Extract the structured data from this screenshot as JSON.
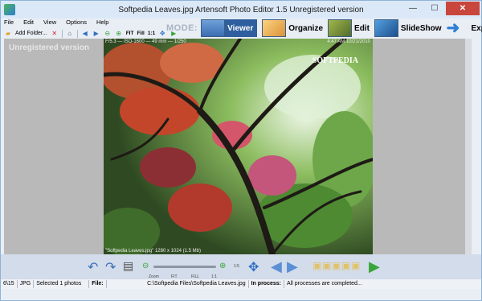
{
  "window": {
    "title": "Softpedia Leaves.jpg        Artensoft Photo Editor 1.5  Unregistered version",
    "min_symbol": "—",
    "max_symbol": "☐",
    "close_symbol": "✕"
  },
  "menu": [
    "File",
    "Edit",
    "View",
    "Options",
    "Help"
  ],
  "toolbar": {
    "add_folder": "Add Folder...",
    "fit": "FIT",
    "fill": "Fill",
    "one_to_one": "1:1"
  },
  "mode": {
    "label": "MODE:",
    "buttons": [
      "Viewer",
      "Organize",
      "Edit",
      "SlideShow",
      "Export"
    ],
    "active": "Viewer"
  },
  "canvas": {
    "unregistered": "Unregistered version",
    "photo_info_top": "F/5.3 — ISO-1600 — 49 mm — 1/250",
    "photo_time": "4:47 AM 10/21/2010",
    "watermark": "SOFTPEDIA",
    "photo_info_bottom": "\"Softpedia Leaves.jpg\"   1280 x 1024   (1.5 Mb)"
  },
  "bottom": {
    "zoom_label": "Zoom",
    "fit_label": "FIT",
    "fill_label": "FILL",
    "one_label": "1:1",
    "ratio_label": "1:5"
  },
  "status": {
    "position": "6\\15",
    "format": "JPG",
    "selected": "Selected 1 photos",
    "file_label": "File:",
    "file_path": "C:\\Softpedia Files\\Softpedia Leaves.jpg",
    "process_label": "In process:",
    "process_text": "All processes are completed..."
  },
  "colors": {
    "accent": "#2f5f9e",
    "canvas_bg": "#b9b9b9"
  }
}
